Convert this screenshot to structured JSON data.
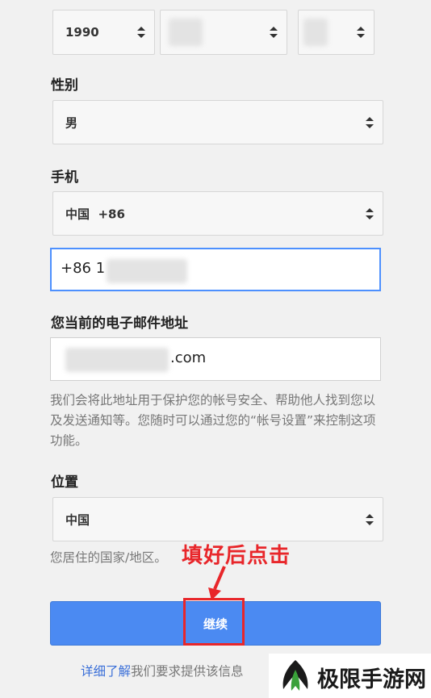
{
  "birthday": {
    "year": "1990",
    "month": "",
    "day": ""
  },
  "gender": {
    "label": "性别",
    "value": "男"
  },
  "phone": {
    "label": "手机",
    "country": "中国  +86",
    "number": "+86 1"
  },
  "email": {
    "label": "您当前的电子邮件地址",
    "value_suffix": ".com",
    "help": "我们会将此地址用于保护您的帐号安全、帮助他人找到您以及发送通知等。您随时可以通过您的“帐号设置”来控制这项功能。"
  },
  "location": {
    "label": "位置",
    "value": "中国",
    "help": "您居住的国家/地区。"
  },
  "annotation": {
    "text": "填好后点击",
    "color": "#e8262a"
  },
  "continue_button": {
    "label": "继续"
  },
  "footer": {
    "link": "详细了解",
    "text": "我们要求提供该信息"
  },
  "watermark": {
    "text": "极限手游网"
  },
  "colors": {
    "accent": "#4b8af2",
    "annotation": "#e8262a"
  }
}
